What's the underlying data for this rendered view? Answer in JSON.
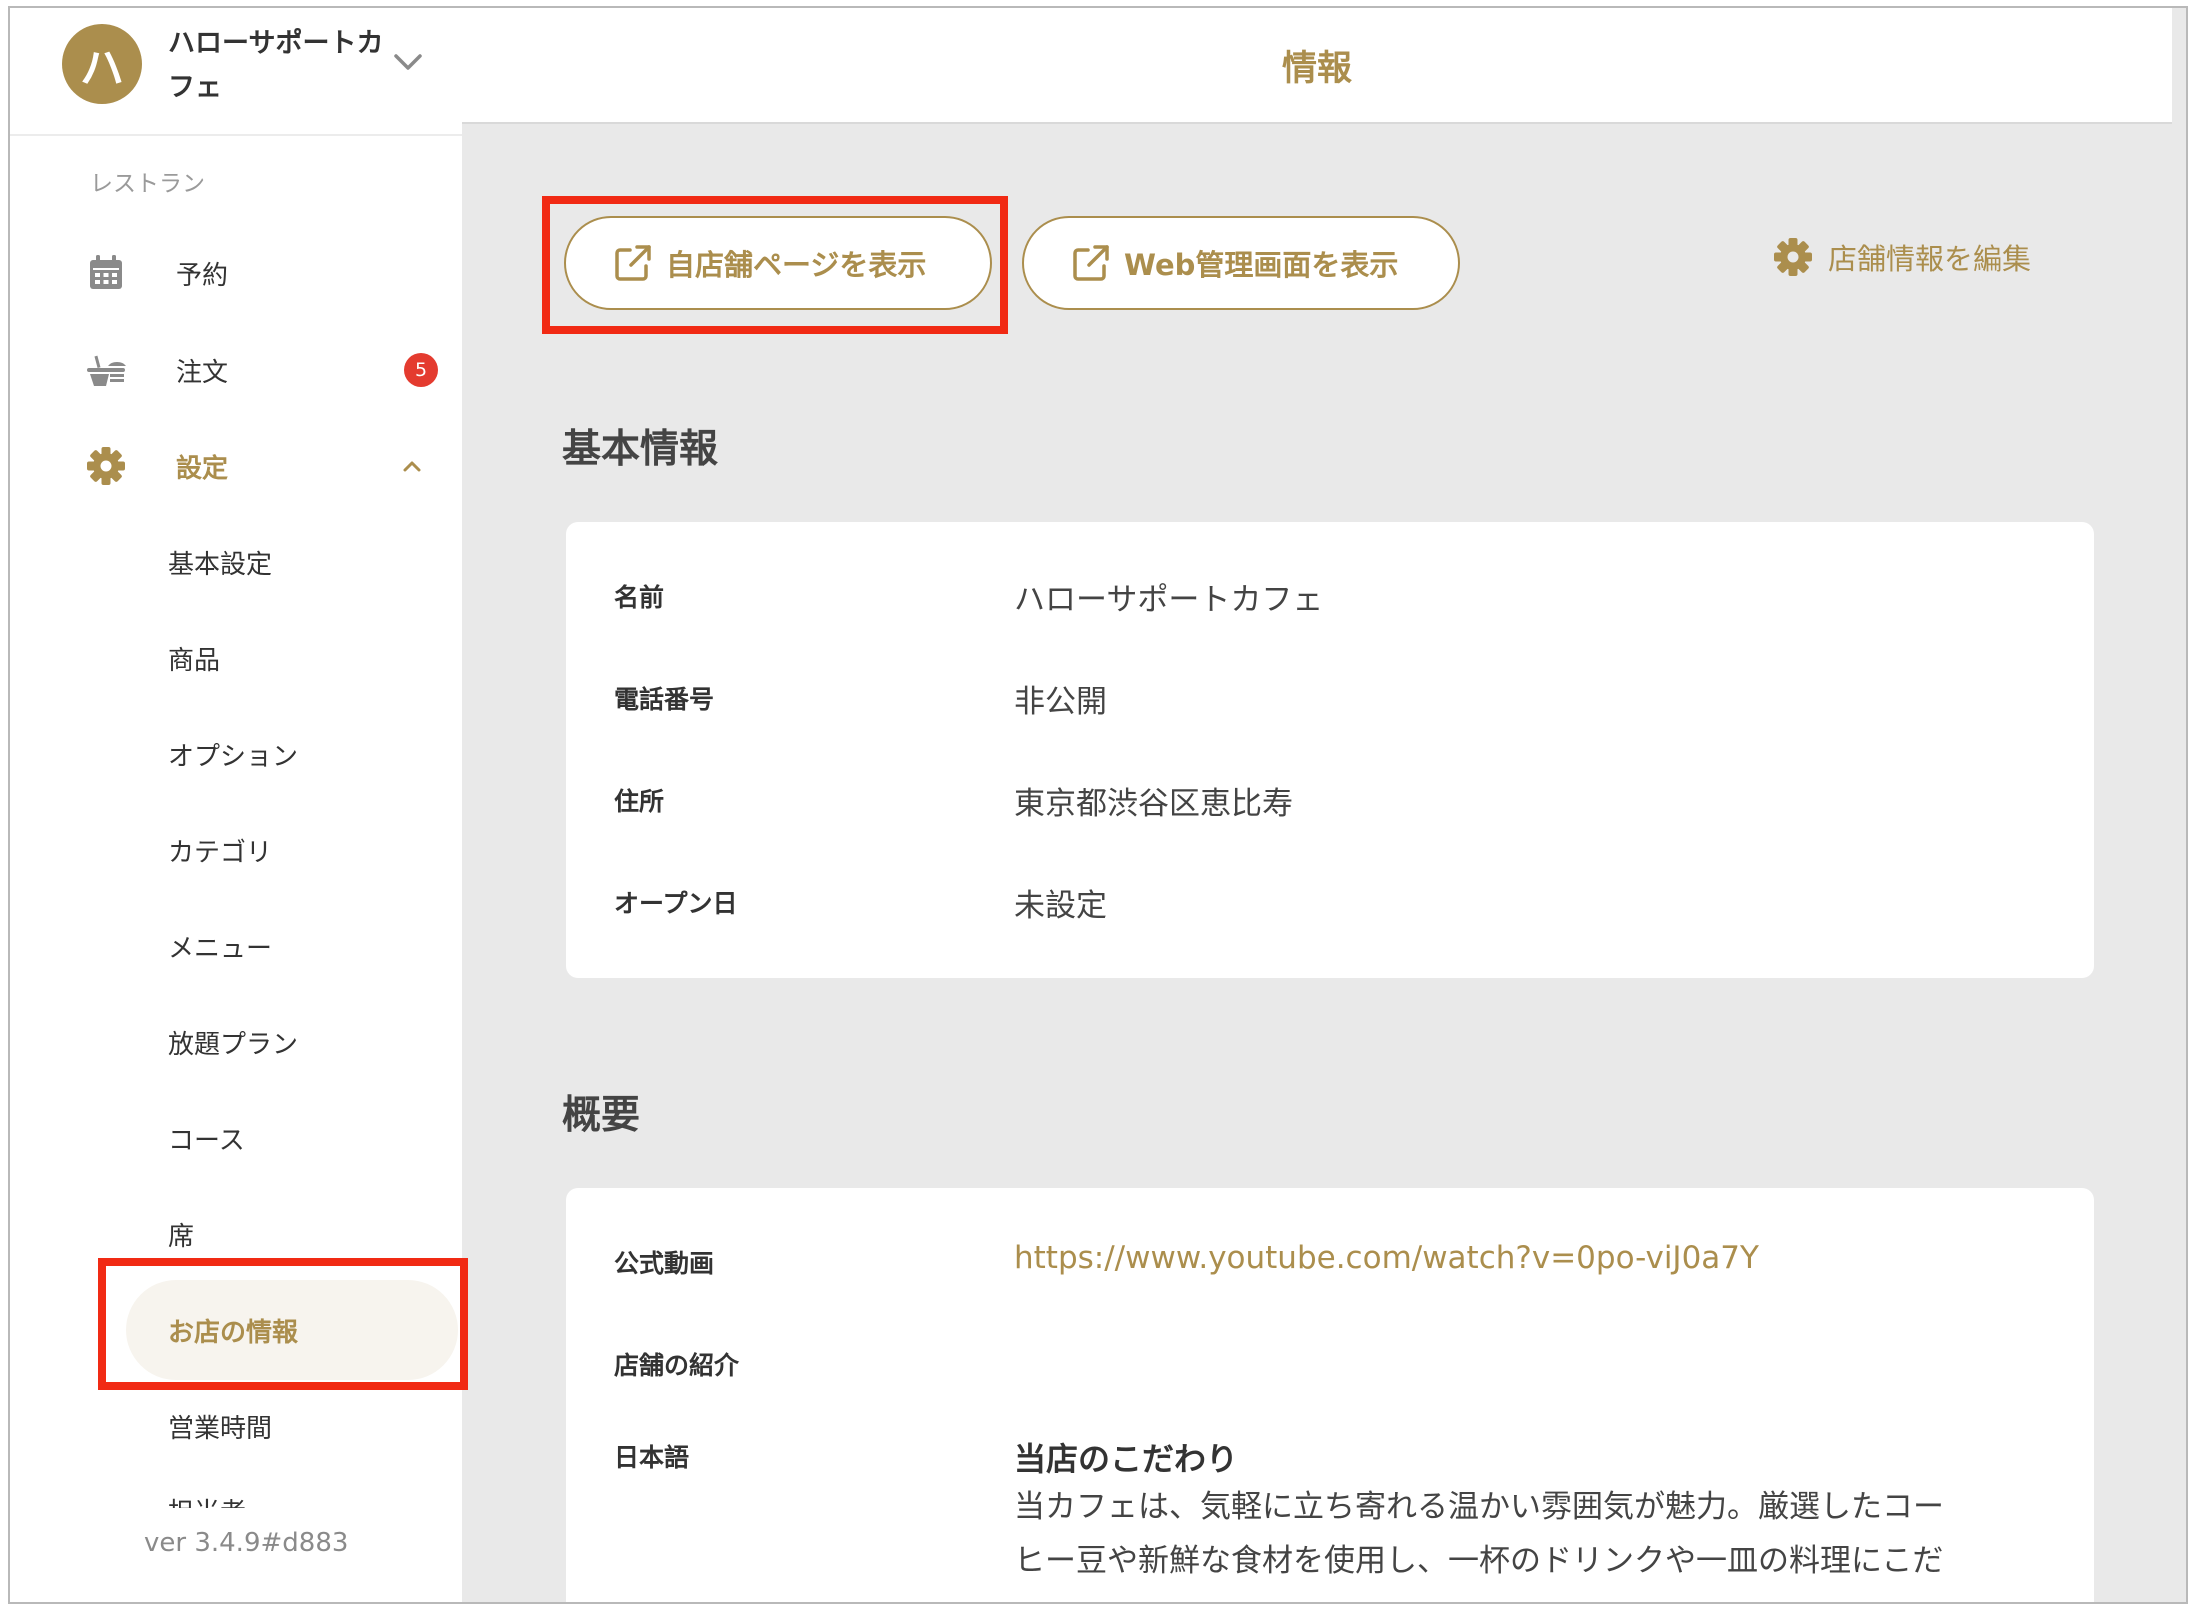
{
  "sidebar": {
    "avatar_letter": "ハ",
    "store_name": "ハローサポートカフェ",
    "section_label": "レストラン",
    "items": [
      {
        "label": "予約",
        "icon": "calendar-icon"
      },
      {
        "label": "注文",
        "icon": "food-tray-icon",
        "badge": "5"
      },
      {
        "label": "設定",
        "icon": "gear-icon"
      }
    ],
    "settings_items": [
      {
        "label": "基本設定"
      },
      {
        "label": "商品"
      },
      {
        "label": "オプション"
      },
      {
        "label": "カテゴリ"
      },
      {
        "label": "メニュー"
      },
      {
        "label": "放題プラン"
      },
      {
        "label": "コース"
      },
      {
        "label": "席"
      },
      {
        "label": "お店の情報",
        "active": true
      },
      {
        "label": "営業時間"
      },
      {
        "label": "担当者"
      }
    ],
    "version": "ver 3.4.9#d883"
  },
  "header": {
    "title": "情報"
  },
  "actions": {
    "view_store_page": "自店舗ページを表示",
    "view_web_admin": "Web管理画面を表示",
    "edit_store_info": "店舗情報を編集"
  },
  "basic_info": {
    "title": "基本情報",
    "rows": [
      {
        "label": "名前",
        "value": "ハローサポートカフェ"
      },
      {
        "label": "電話番号",
        "value": "非公開"
      },
      {
        "label": "住所",
        "value": "東京都渋谷区恵比寿"
      },
      {
        "label": "オープン日",
        "value": "未設定"
      }
    ]
  },
  "overview": {
    "title": "概要",
    "video_label": "公式動画",
    "video_url": "https://www.youtube.com/watch?v=0po-viJ0a7Y",
    "intro_label": "店舗の紹介",
    "lang_label": "日本語",
    "intro_heading": "当店のこだわり",
    "intro_body_line1": "当カフェは、気軽に立ち寄れる温かい雰囲気が魅力。厳選したコー",
    "intro_body_line2": "ヒー豆や新鮮な食材を使用し、一杯のドリンクや一皿の料理にこだ"
  },
  "colors": {
    "accent": "#ab8e4d",
    "badge": "#e43b2f",
    "highlight_box": "#f12a14",
    "main_bg": "#e9e9e9"
  }
}
